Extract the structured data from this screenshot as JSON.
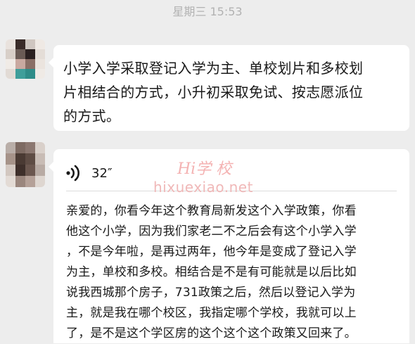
{
  "timestamp": "星期三 15:53",
  "messages": [
    {
      "text": "小学入学采取登记入学为主、单校划片和多校划片相结合的方式，小升初采取免试、按志愿派位的方式。",
      "lines": [
        "小学入学采取登记入学为主、单校划片和多校划",
        "片相结合的方式，小升初采取免试、按志愿派位",
        "的方式。"
      ]
    },
    {
      "voice_icon": "voice-waves-icon",
      "duration": "32″",
      "transcript_lines": [
        "亲爱的，你看今年这个教育局新发这个入学政策，你看",
        "他这个小学，因为我们家老二不之后会有这个小学入学",
        "，不是今年啦，是再过两年，他今年是变成了登记入学",
        "为主，单校和多校。相结合是不是有可能就是以后比如",
        "说我西城那个房子，731政策之后，然后以登记入学为",
        "主，就是我在哪个校区，我指定哪个学校，我就可以上",
        "了，是不是这个学区房的这个这个这个政策又回来了。"
      ]
    }
  ],
  "watermark": {
    "logo": "Hi学 校",
    "url": "hixuexiao.net"
  },
  "colors": {
    "background": "#ededed",
    "bubble": "#ffffff",
    "text": "#191919",
    "timestamp": "#b2b2b2",
    "watermark": "#f3a5a5"
  }
}
